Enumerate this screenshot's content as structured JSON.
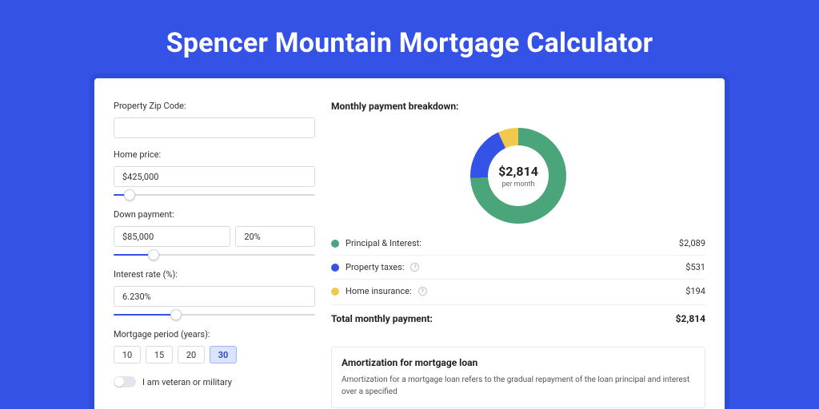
{
  "page": {
    "title": "Spencer Mountain Mortgage Calculator"
  },
  "colors": {
    "principal": "#4aa57a",
    "taxes": "#3452e5",
    "insurance": "#f3c94d"
  },
  "form": {
    "zip": {
      "label": "Property Zip Code:",
      "value": ""
    },
    "price": {
      "label": "Home price:",
      "value": "$425,000",
      "slider_pct": 8
    },
    "down": {
      "label": "Down payment:",
      "amount": "$85,000",
      "pct": "20%",
      "slider_pct": 20
    },
    "rate": {
      "label": "Interest rate (%):",
      "value": "6.230%",
      "slider_pct": 31
    },
    "period": {
      "label": "Mortgage period (years):",
      "options": [
        "10",
        "15",
        "20",
        "30"
      ],
      "active_index": 3
    },
    "veteran": {
      "label": "I am veteran or military",
      "checked": false
    }
  },
  "breakdown": {
    "title": "Monthly payment breakdown:",
    "center_amount": "$2,814",
    "center_sub": "per month",
    "items": [
      {
        "label": "Principal & Interest:",
        "value": "$2,089",
        "colorKey": "principal",
        "help": false
      },
      {
        "label": "Property taxes:",
        "value": "$531",
        "colorKey": "taxes",
        "help": true
      },
      {
        "label": "Home insurance:",
        "value": "$194",
        "colorKey": "insurance",
        "help": true
      }
    ],
    "total_label": "Total monthly payment:",
    "total_value": "$2,814"
  },
  "amortization": {
    "title": "Amortization for mortgage loan",
    "text": "Amortization for a mortgage loan refers to the gradual repayment of the loan principal and interest over a specified"
  },
  "chart_data": {
    "type": "pie",
    "title": "Monthly payment breakdown",
    "series": [
      {
        "name": "Principal & Interest",
        "value": 2089,
        "color": "#4aa57a"
      },
      {
        "name": "Property taxes",
        "value": 531,
        "color": "#3452e5"
      },
      {
        "name": "Home insurance",
        "value": 194,
        "color": "#f3c94d"
      }
    ],
    "total": 2814,
    "center_label": "$2,814 per month"
  }
}
